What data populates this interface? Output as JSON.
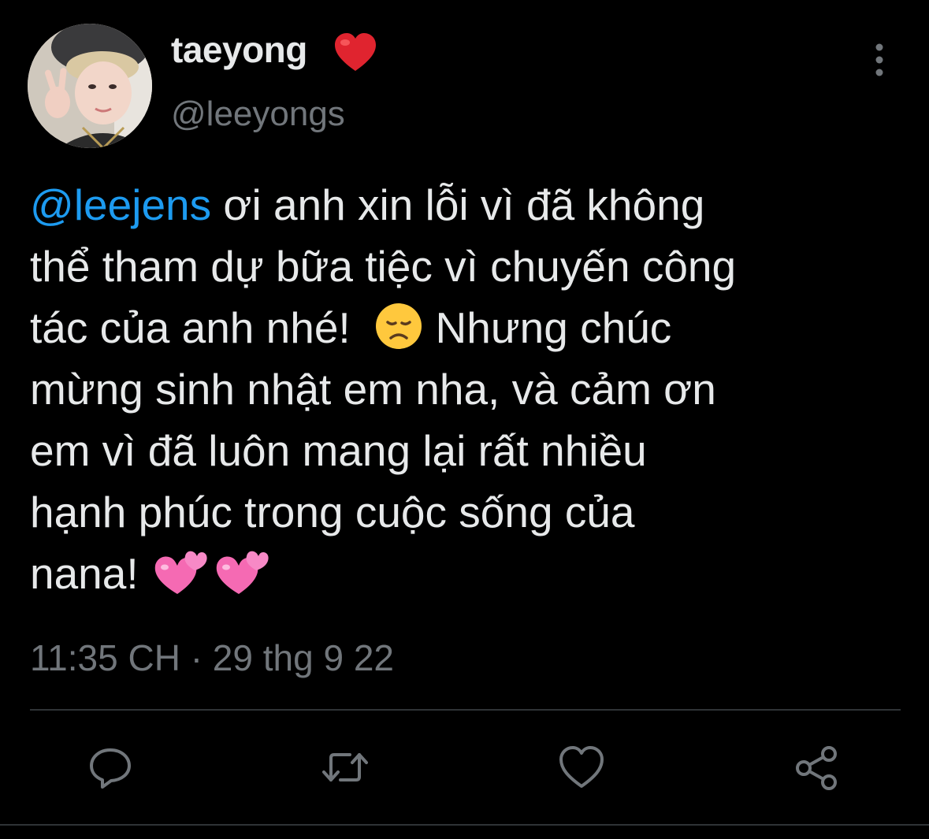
{
  "author": {
    "display_name": "taeyong",
    "name_emoji": "red-heart",
    "handle": "@leeyongs",
    "avatar": "avatar-photo"
  },
  "tweet": {
    "lines": [
      {
        "mention": "@leejens",
        "text": " ơi anh xin lỗi vì đã không"
      },
      {
        "text": "thể tham dự bữa tiệc vì chuyến công"
      },
      {
        "text": "tác của anh nhé!  ",
        "emoji": "disappointed-face",
        "text_after": " Nhưng chúc"
      },
      {
        "text": "mừng sinh nhật em nha, và cảm ơn"
      },
      {
        "text": "em vì đã luôn mang lại rất nhiều"
      },
      {
        "text": "hạnh phúc trong cuộc sống của"
      },
      {
        "text": "nana! ",
        "emoji": "two-hearts"
      }
    ],
    "timestamp": "11:35 CH · 29 thg 9 22"
  },
  "actions": [
    {
      "name": "reply",
      "icon": "reply-icon"
    },
    {
      "name": "retweet",
      "icon": "retweet-icon"
    },
    {
      "name": "like",
      "icon": "heart-icon"
    },
    {
      "name": "share",
      "icon": "share-icon"
    }
  ],
  "colors": {
    "background": "#000000",
    "text": "#e7e9ea",
    "secondary_text": "#71767b",
    "mention": "#1d9bf0",
    "divider": "#2f3336"
  }
}
